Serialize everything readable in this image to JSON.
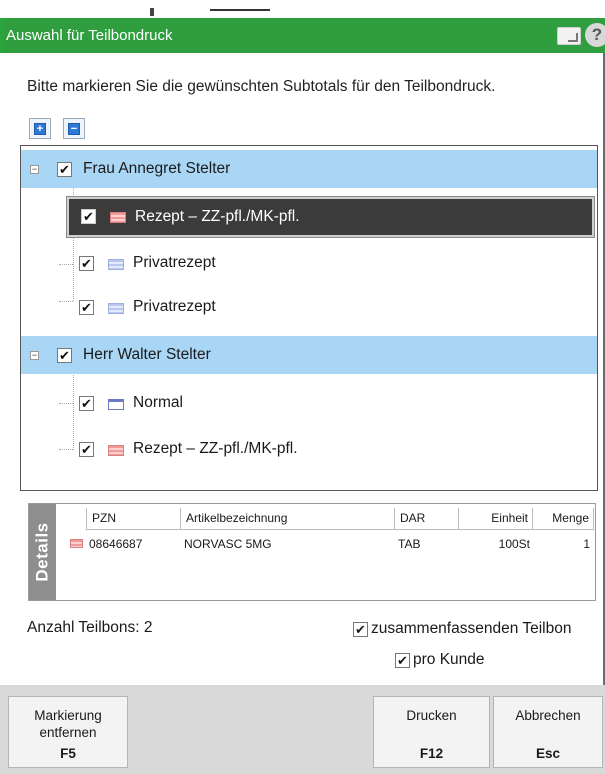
{
  "window": {
    "title": "Auswahl für Teilbondruck",
    "help_glyph": "?"
  },
  "instruction": "Bitte markieren Sie die gewünschten Subtotals für den Teilbondruck.",
  "toolbar": {
    "expand_all_glyph": "+",
    "collapse_all_glyph": "−"
  },
  "tree": {
    "groups": [
      {
        "label": "Frau Annegret Stelter",
        "checked": true,
        "items": [
          {
            "label": "Rezept – ZZ-pfl./MK-pfl.",
            "icon": "red-prescription-icon",
            "checked": true,
            "selected": true
          },
          {
            "label": "Privatrezept",
            "icon": "blue-prescription-icon",
            "checked": true
          },
          {
            "label": "Privatrezept",
            "icon": "blue-prescription-icon",
            "checked": true
          }
        ]
      },
      {
        "label": "Herr Walter Stelter",
        "checked": true,
        "items": [
          {
            "label": "Normal",
            "icon": "normal-prescription-icon",
            "checked": true
          },
          {
            "label": "Rezept – ZZ-pfl./MK-pfl.",
            "icon": "red-prescription-icon",
            "checked": true
          }
        ]
      }
    ],
    "check_glyph": "✔",
    "expander_glyph": "−"
  },
  "details": {
    "side_label": "Details",
    "columns": [
      "PZN",
      "Artikelbezeichnung",
      "DAR",
      "Einheit",
      "Menge"
    ],
    "rows": [
      {
        "pzn": "08646687",
        "name": "NORVASC 5MG",
        "dar": "TAB",
        "einheit": "100St",
        "menge": "1"
      }
    ]
  },
  "summary": {
    "anzahl_label": "Anzahl Teilbons: 2"
  },
  "options": {
    "combined_label": "zusammenfassenden Teilbon",
    "combined_checked": true,
    "per_customer_label": "pro Kunde",
    "per_customer_checked": true
  },
  "footer": {
    "remove_mark_label_1": "Markierung",
    "remove_mark_label_2": "entfernen",
    "remove_mark_key": "F5",
    "print_label": "Drucken",
    "print_key": "F12",
    "cancel_label": "Abbrechen",
    "cancel_key": "Esc"
  },
  "colors": {
    "titlebar": "#2f9e3f",
    "group_row": "#a9d6f5",
    "selected_row": "#3b3b3b",
    "footer": "#d9d9d9"
  }
}
